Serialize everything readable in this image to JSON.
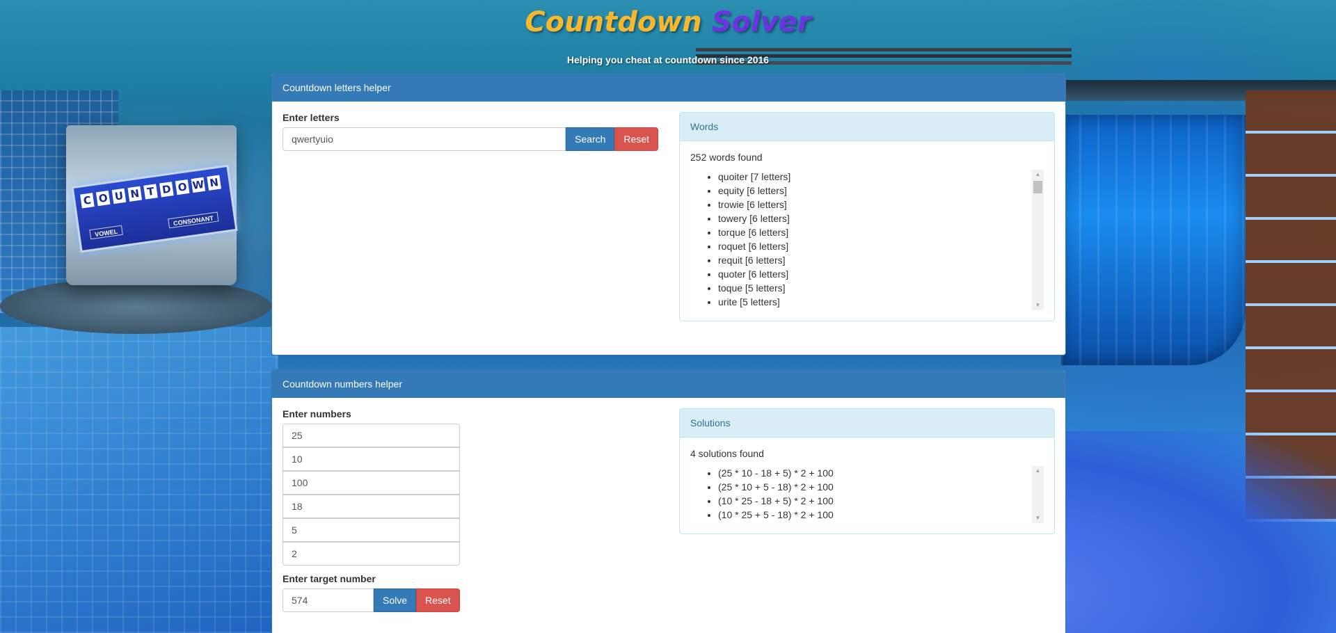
{
  "site": {
    "title_part1": "Countdown",
    "title_part2": "Solver",
    "subtitle": "Helping you cheat at countdown since 2016"
  },
  "background_board": {
    "letters": [
      "C",
      "O",
      "U",
      "N",
      "T",
      "D",
      "O",
      "W",
      "N"
    ],
    "vowel_label": "VOWEL",
    "consonant_label": "CONSONANT"
  },
  "letters_helper": {
    "heading": "Countdown letters helper",
    "input_label": "Enter letters",
    "input_value": "qwertyuio",
    "search_label": "Search",
    "reset_label": "Reset",
    "results": {
      "heading": "Words",
      "count_text": "252 words found",
      "items": [
        "quoiter [7 letters]",
        "equity [6 letters]",
        "trowie [6 letters]",
        "towery [6 letters]",
        "torque [6 letters]",
        "roquet [6 letters]",
        "requit [6 letters]",
        "quoter [6 letters]",
        "toque [5 letters]",
        "urite [5 letters]"
      ]
    }
  },
  "numbers_helper": {
    "heading": "Countdown numbers helper",
    "input_label": "Enter numbers",
    "numbers": [
      "25",
      "10",
      "100",
      "18",
      "5",
      "2"
    ],
    "target_label": "Enter target number",
    "target_value": "574",
    "solve_label": "Solve",
    "reset_label": "Reset",
    "results": {
      "heading": "Solutions",
      "count_text": "4 solutions found",
      "items": [
        "(25 * 10 - 18 + 5) * 2 + 100",
        "(25 * 10 + 5 - 18) * 2 + 100",
        "(10 * 25 - 18 + 5) * 2 + 100",
        "(10 * 25 + 5 - 18) * 2 + 100"
      ]
    }
  },
  "colors": {
    "primary": "#337ab7",
    "danger": "#d9534f",
    "info_bg": "#d9edf7",
    "title_yellow": "#f5b82e",
    "title_purple": "#6a35e0"
  }
}
